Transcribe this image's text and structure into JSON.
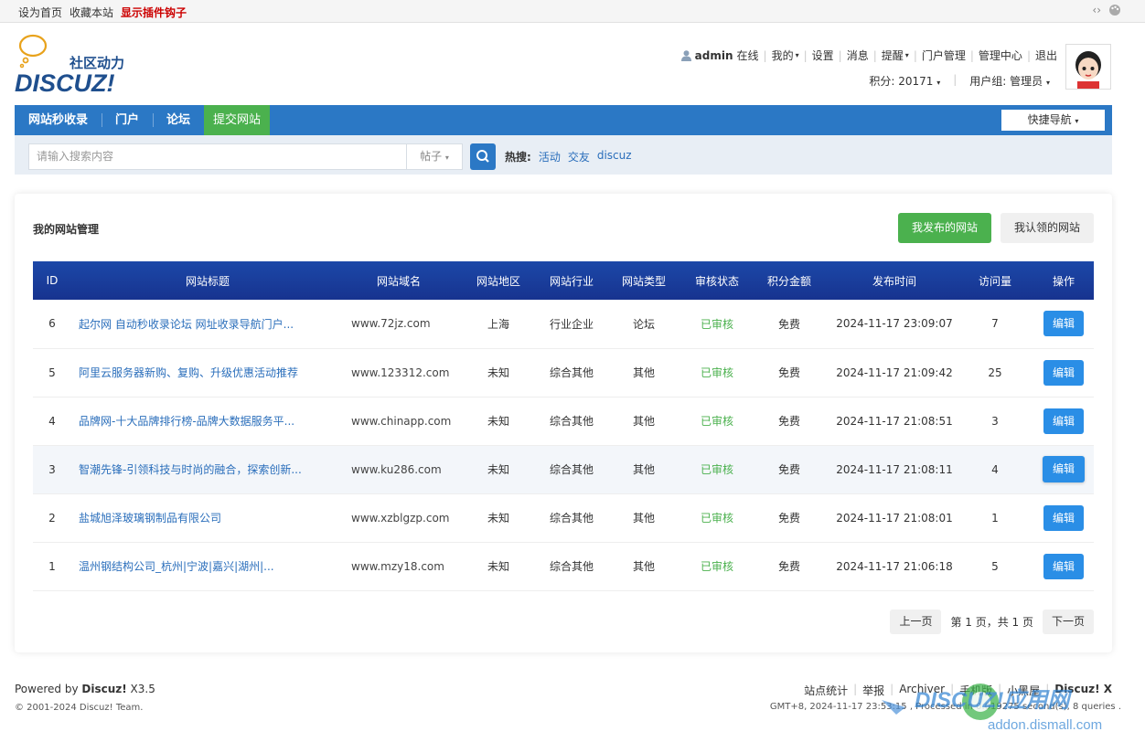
{
  "topbar": {
    "links": [
      "设为首页",
      "收藏本站"
    ],
    "hook": "显示插件钩子",
    "right_icons": [
      "code-icon",
      "palette-icon"
    ],
    "code_glyph": "‹›"
  },
  "logo": {
    "cn": "社区动力",
    "en": "DISCUZ!"
  },
  "user": {
    "name": "admin",
    "status": "在线",
    "menu": [
      "我的",
      "设置",
      "消息",
      "提醒",
      "门户管理",
      "管理中心",
      "退出"
    ],
    "points_label": "积分: 20171",
    "group_label": "用户组: 管理员"
  },
  "nav": {
    "items": [
      "网站秒收录",
      "门户",
      "论坛",
      "提交网站"
    ],
    "quick": "快捷导航"
  },
  "search": {
    "placeholder": "请输入搜索内容",
    "type": "帖子",
    "hot_label": "热搜:",
    "hot_words": [
      "活动",
      "交友",
      "discuz"
    ]
  },
  "panel": {
    "title": "我的网站管理",
    "btn_mine": "我发布的网站",
    "btn_claim": "我认领的网站"
  },
  "table": {
    "headers": [
      "ID",
      "网站标题",
      "网站域名",
      "网站地区",
      "网站行业",
      "网站类型",
      "审核状态",
      "积分金额",
      "发布时间",
      "访问量",
      "操作"
    ],
    "rows": [
      {
        "id": "6",
        "title": "起尔网 自动秒收录论坛 网址收录导航门户...",
        "domain": "www.72jz.com",
        "region": "上海",
        "industry": "行业企业",
        "type": "论坛",
        "status": "已审核",
        "price": "免费",
        "time": "2024-11-17 23:09:07",
        "views": "7",
        "action": "编辑"
      },
      {
        "id": "5",
        "title": "阿里云服务器新购、复购、升级优惠活动推荐",
        "domain": "www.123312.com",
        "region": "未知",
        "industry": "综合其他",
        "type": "其他",
        "status": "已审核",
        "price": "免费",
        "time": "2024-11-17 21:09:42",
        "views": "25",
        "action": "编辑"
      },
      {
        "id": "4",
        "title": "品牌网-十大品牌排行榜-品牌大数据服务平...",
        "domain": "www.chinapp.com",
        "region": "未知",
        "industry": "综合其他",
        "type": "其他",
        "status": "已审核",
        "price": "免费",
        "time": "2024-11-17 21:08:51",
        "views": "3",
        "action": "编辑"
      },
      {
        "id": "3",
        "title": "智潮先锋-引领科技与时尚的融合，探索创新...",
        "domain": "www.ku286.com",
        "region": "未知",
        "industry": "综合其他",
        "type": "其他",
        "status": "已审核",
        "price": "免费",
        "time": "2024-11-17 21:08:11",
        "views": "4",
        "action": "编辑"
      },
      {
        "id": "2",
        "title": "盐城旭泽玻璃钢制品有限公司",
        "domain": "www.xzblgzp.com",
        "region": "未知",
        "industry": "综合其他",
        "type": "其他",
        "status": "已审核",
        "price": "免费",
        "time": "2024-11-17 21:08:01",
        "views": "1",
        "action": "编辑"
      },
      {
        "id": "1",
        "title": "温州钢结构公司_杭州|宁波|嘉兴|湖州|...",
        "domain": "www.mzy18.com",
        "region": "未知",
        "industry": "综合其他",
        "type": "其他",
        "status": "已审核",
        "price": "免费",
        "time": "2024-11-17 21:06:18",
        "views": "5",
        "action": "编辑"
      }
    ]
  },
  "pager": {
    "prev": "上一页",
    "info": "第 1 页，共 1 页",
    "next": "下一页"
  },
  "footer": {
    "powered_prefix": "Powered by ",
    "powered_brand": "Discuz!",
    "powered_version": " X3.5",
    "copyright": "© 2001-2024 Discuz! Team.",
    "links": [
      "站点统计",
      "举报",
      "Archiver",
      "手机版",
      "小黑屋"
    ],
    "brand": "Discuz! X",
    "gmt": "GMT+8, 2024-11-17 23:53:15 , Processed in 0.019275 second(s), 8 queries ."
  },
  "watermark": {
    "text": "DISCUZ!应用网",
    "url": "addon.dismall.com"
  },
  "colors": {
    "nav": "#2b78c5",
    "active": "#4bb14e",
    "table_header": "#1b3e9d",
    "link": "#2a6ebb",
    "edit": "#2a8ee6"
  }
}
